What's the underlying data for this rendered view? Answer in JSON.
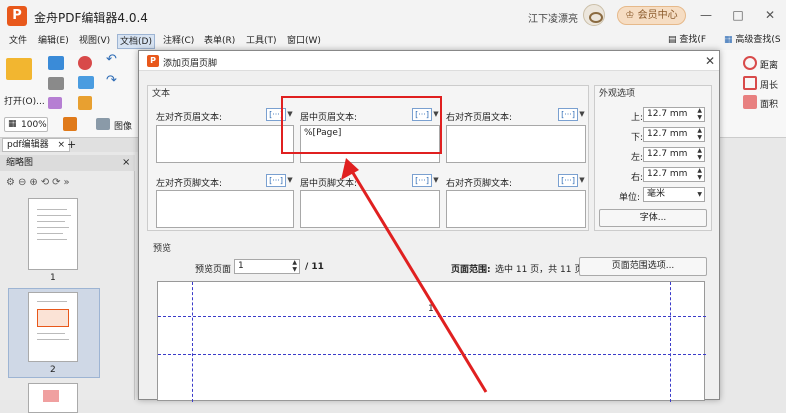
{
  "app": {
    "logo": "P",
    "title": "金舟PDF编辑器4.0.4",
    "user": "江下凌漂亮",
    "vip": "会员中心",
    "controls": [
      "—",
      "□",
      "✕"
    ]
  },
  "menu": {
    "items": [
      "文件",
      "编辑(E)",
      "视图(V)",
      "文档(D)",
      "注释(C)",
      "表单(R)",
      "工具(T)",
      "窗口(W)"
    ],
    "active": "文档(D)",
    "find": "查找(F",
    "advanced_find": "高级查找(S"
  },
  "toolbar": {
    "open": "打开(O)...",
    "zoom": "100%",
    "image": "图像",
    "side_tools": [
      "距离",
      "周长",
      "面积"
    ]
  },
  "tabs": {
    "doc": "pdf编辑器",
    "close": "×",
    "add": "+"
  },
  "sidebar": {
    "title": "缩略图",
    "close": "×",
    "pages": [
      "1",
      "2"
    ]
  },
  "dialog": {
    "title": "添加页眉页脚",
    "close": "✕",
    "text_group": "文本",
    "appearance_group": "外观选项",
    "preview_group": "预览",
    "fields": {
      "left_header": "左对齐页眉文本:",
      "center_header": "居中页眉文本:",
      "right_header": "右对齐页眉文本:",
      "left_footer": "左对齐页脚文本:",
      "center_footer": "居中页脚文本:",
      "right_footer": "右对齐页脚文本:"
    },
    "center_header_value": "%[Page]",
    "insert_icon": "[···]",
    "margins": [
      {
        "label": "上:",
        "value": "12.7 mm"
      },
      {
        "label": "下:",
        "value": "12.7 mm"
      },
      {
        "label": "左:",
        "value": "12.7 mm"
      },
      {
        "label": "右:",
        "value": "12.7 mm"
      }
    ],
    "unit_label": "单位:",
    "unit_value": "毫米",
    "font_button": "字体...",
    "preview_page_label": "预览页面",
    "preview_page_value": "1",
    "preview_total": "/ 11",
    "page_range_label": "页面范围:",
    "page_range_text": "选中 11 页，共 11 页",
    "page_range_button": "页面范围选项...",
    "preview_number": "1"
  },
  "colors": {
    "accent": "#e8581b",
    "highlight": "#e02020",
    "guide": "#3b3bc9"
  }
}
